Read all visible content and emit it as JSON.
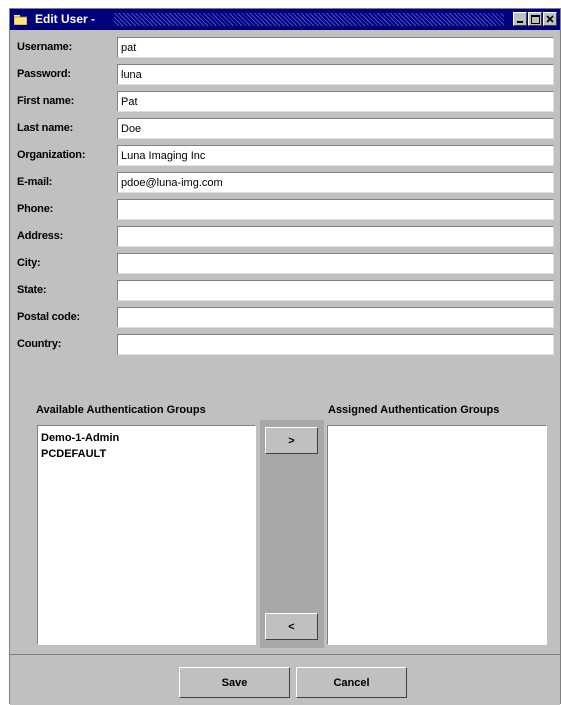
{
  "window": {
    "title": "Edit User -"
  },
  "form": {
    "fields": [
      {
        "label": "Username:",
        "value": "pat"
      },
      {
        "label": "Password:",
        "value": "luna"
      },
      {
        "label": "First name:",
        "value": "Pat"
      },
      {
        "label": "Last name:",
        "value": "Doe"
      },
      {
        "label": "Organization:",
        "value": "Luna Imaging Inc"
      },
      {
        "label": "E-mail:",
        "value": "pdoe@luna-img.com"
      },
      {
        "label": "Phone:",
        "value": ""
      },
      {
        "label": "Address:",
        "value": ""
      },
      {
        "label": "City:",
        "value": ""
      },
      {
        "label": "State:",
        "value": ""
      },
      {
        "label": "Postal code:",
        "value": ""
      },
      {
        "label": "Country:",
        "value": ""
      }
    ]
  },
  "groups": {
    "available_header": "Available Authentication Groups",
    "assigned_header": "Assigned Authentication Groups",
    "available": [
      "Demo-1-Admin",
      "PCDEFAULT"
    ],
    "assigned": [],
    "add_label": ">",
    "remove_label": "<"
  },
  "actions": {
    "save_label": "Save",
    "cancel_label": "Cancel"
  },
  "icons": {
    "window_icon": "folder-icon",
    "minimize": "minimize-icon",
    "maximize": "maximize-icon",
    "close": "close-icon"
  },
  "colors": {
    "titlebar": "#00007b",
    "window_bg": "#c0c0c0"
  }
}
